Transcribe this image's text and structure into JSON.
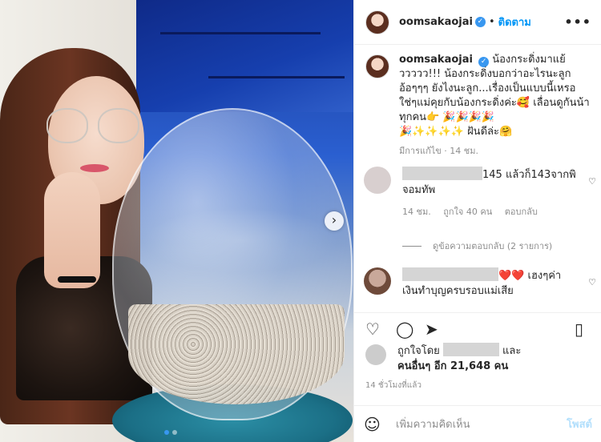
{
  "post": {
    "username": "oomsakaojai",
    "follow_label": "ติดตาม",
    "more_label": "•••",
    "caption_lines": [
      "น้องกระดิ่งมาแย้ววววว!!! น้องกระดิ่งบอกว่าอะไรนะลูก อ้อๆๆๆ ยังไงนะลูก...เรื่องเป็นแบบนี้เหรอ ใช่ๆแม่คุยกับน้องกระดิ่งค่ะ🥰 เลื่อนดูกันน้าทุกคน👉 🎉🎉🎉🎉",
      "🎉✨✨✨✨ ฝันดีล่ะ🤗"
    ],
    "caption_meta": "มีการแก้ไข · 14 ชม."
  },
  "comments": [
    {
      "text_after_blur": "145 แล้วก็143จากพิจอมทัพ",
      "time": "14 ชม.",
      "likes": "ถูกใจ 40 คน",
      "reply_label": "ตอบกลับ"
    },
    {
      "text_after_blur": "❤️❤️ เฮงๆค่า เงินทำบุญครบรอบแม่เสีย"
    }
  ],
  "view_replies": "ดูข้อความตอบกลับ (2 รายการ)",
  "likes": {
    "prefix": "ถูกใจโดย",
    "suffix": "และ",
    "others": "คนอื่นๆ อีก 21,648 คน"
  },
  "timestamp": "14 ชั่วโมงที่แล้ว",
  "add_comment": {
    "placeholder": "เพิ่มความคิดเห็น",
    "post_label": "โพสต์"
  },
  "icons": {
    "heart": "heart-icon",
    "comment": "comment-icon",
    "share": "share-icon",
    "save": "bookmark-icon",
    "emoji": "emoji-icon"
  }
}
